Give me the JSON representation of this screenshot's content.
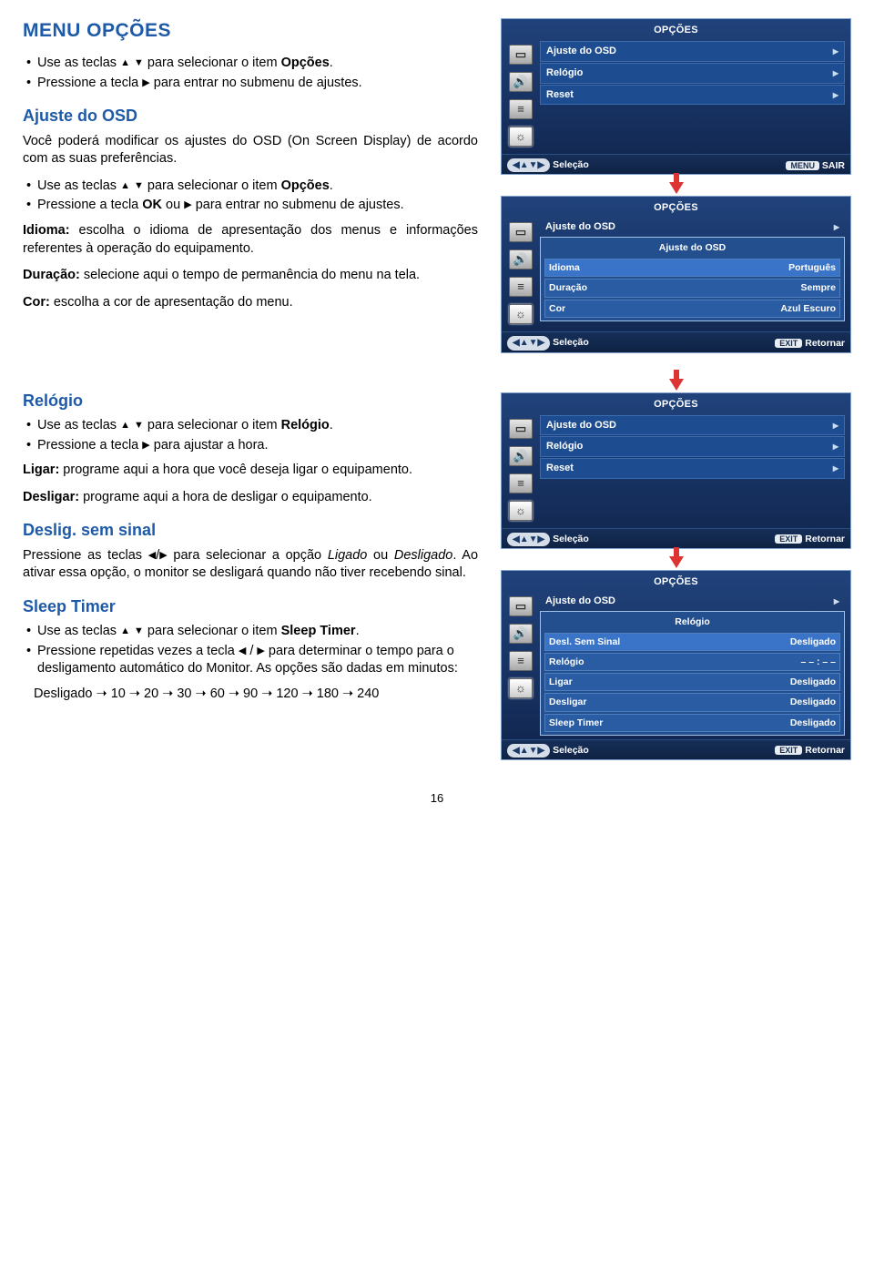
{
  "title": "MENU OPÇÕES",
  "intro": {
    "b1_a": "Use as teclas ",
    "b1_b": " para selecionar o item ",
    "b1_bold": "Opções",
    "b1_c": ".",
    "b2_a": "Pressione a tecla ",
    "b2_b": " para entrar no submenu de ajustes."
  },
  "ajuste": {
    "head": "Ajuste do OSD",
    "p1": "Você poderá modificar os ajustes do OSD (On Screen Display) de acordo com as suas preferências.",
    "b1_a": "Use as teclas ",
    "b1_b": " para selecionar o item ",
    "b1_bold": "Opções",
    "b1_c": ".",
    "b2_a": "Pressione a tecla ",
    "b2_ok": "OK",
    "b2_b": " ou ",
    "b2_c": " para entrar no submenu de ajustes.",
    "idioma_t": "Idioma:",
    "idioma_p": " escolha o idioma de apresentação dos menus e informações referentes à operação do equipamento.",
    "duracao_t": "Duração:",
    "duracao_p": " selecione aqui o tempo de permanência do menu na tela.",
    "cor_t": "Cor:",
    "cor_p": " escolha a cor de apresentação do menu."
  },
  "relogio": {
    "head": "Relógio",
    "b1_a": "Use as teclas ",
    "b1_b": " para selecionar o item ",
    "b1_bold": "Relógio",
    "b1_c": ".",
    "b2_a": "Pressione a tecla ",
    "b2_b": " para ajustar a hora.",
    "ligar_t": "Ligar:",
    "ligar_p": " programe aqui a hora que você deseja ligar o equipamento.",
    "desl_t": "Desligar:",
    "desl_p": " programe aqui a hora de desligar o equipamento."
  },
  "deslig": {
    "head": "Deslig. sem sinal",
    "p_a": "Pressione as teclas ",
    "p_b": " para selecionar a opção ",
    "p_lig": "Ligado",
    "p_ou": " ou ",
    "p_desl": "Desligado",
    "p_c": ". Ao ativar essa opção, o monitor se desligará quando não tiver recebendo sinal."
  },
  "sleep": {
    "head": "Sleep Timer",
    "b1_a": "Use as teclas ",
    "b1_b": " para selecionar o item ",
    "b1_bold": "Sleep Timer",
    "b1_c": ".",
    "b2_a": "Pressione repetidas vezes a tecla ",
    "b2_b": " para determinar o tempo para o desligamento automático do Monitor. As opções são dadas em minutos:",
    "seq": "Desligado ➝ 10 ➝ 20 ➝ 30 ➝ 60 ➝ 90 ➝ 120 ➝ 180 ➝ 240"
  },
  "osd1": {
    "title": "OPÇÕES",
    "items": [
      "Ajuste do OSD",
      "Relógio",
      "Reset"
    ],
    "footer_sel": "Seleção",
    "footer_btn": "MENU",
    "footer_act": "SAIR"
  },
  "osd2": {
    "title": "OPÇÕES",
    "top": "Ajuste do OSD",
    "sub_title": "Ajuste do OSD",
    "rows": [
      {
        "k": "Idioma",
        "v": "Português"
      },
      {
        "k": "Duração",
        "v": "Sempre"
      },
      {
        "k": "Cor",
        "v": "Azul Escuro"
      }
    ],
    "footer_sel": "Seleção",
    "footer_btn": "EXIT",
    "footer_act": "Retornar"
  },
  "osd3": {
    "title": "OPÇÕES",
    "items": [
      "Ajuste do OSD",
      "Relógio",
      "Reset"
    ],
    "footer_sel": "Seleção",
    "footer_btn": "EXIT",
    "footer_act": "Retornar"
  },
  "osd4": {
    "title": "OPÇÕES",
    "top": "Ajuste do OSD",
    "sub_title": "Relógio",
    "rows": [
      {
        "k": "Desl. Sem Sinal",
        "v": "Desligado"
      },
      {
        "k": "Relógio",
        "v": "– – : – –"
      },
      {
        "k": "Ligar",
        "v": "Desligado"
      },
      {
        "k": "Desligar",
        "v": "Desligado"
      },
      {
        "k": "Sleep Timer",
        "v": "Desligado"
      }
    ],
    "footer_sel": "Seleção",
    "footer_btn": "EXIT",
    "footer_act": "Retornar"
  },
  "page_number": "16"
}
